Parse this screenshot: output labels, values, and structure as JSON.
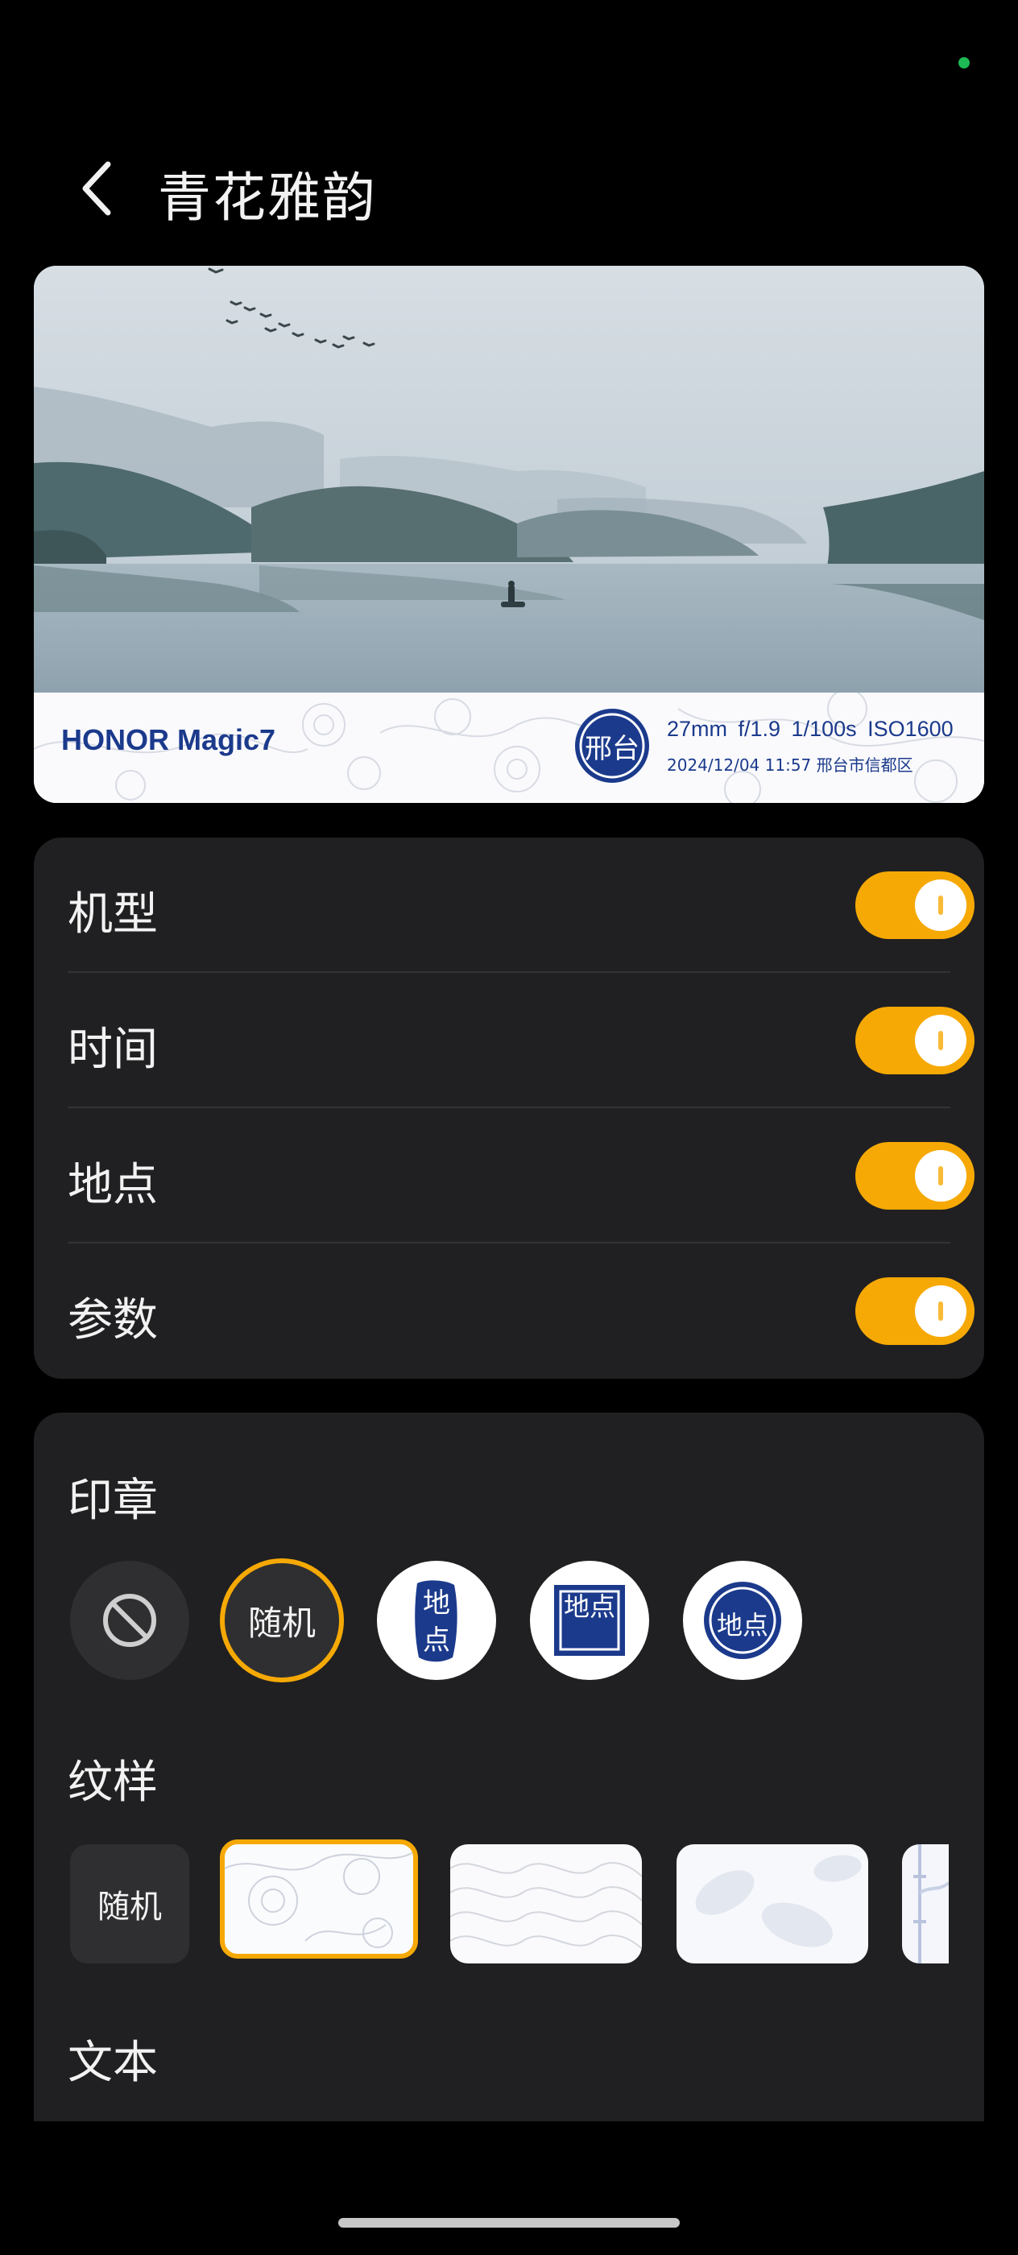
{
  "header": {
    "title": "青花雅韵",
    "back_icon": "back-arrow-icon"
  },
  "preview": {
    "brand": "HONOR Magic7",
    "seal_text": "邢台",
    "params": "27mm f/1.9 1/100s ISO1600",
    "meta": "2024/12/04 11:57 邢台市信都区",
    "accent": "#1b3a8c"
  },
  "toggles": [
    {
      "label": "机型",
      "on": true
    },
    {
      "label": "时间",
      "on": true
    },
    {
      "label": "地点",
      "on": true
    },
    {
      "label": "参数",
      "on": true
    }
  ],
  "stamp": {
    "title": "印章",
    "options": [
      {
        "type": "none",
        "icon": "no-entry-icon"
      },
      {
        "type": "random",
        "label": "随机",
        "selected": true
      },
      {
        "type": "vertical",
        "text": "地点"
      },
      {
        "type": "square",
        "text": "地点"
      },
      {
        "type": "round",
        "text": "地点"
      }
    ]
  },
  "pattern": {
    "title": "纹样",
    "random_label": "随机",
    "options": [
      "peony",
      "clouds",
      "leaves",
      "bamboo"
    ],
    "selected_index": 0
  },
  "text_section": {
    "title": "文本"
  },
  "colors": {
    "accent": "#f6a905",
    "card": "#202022",
    "blue": "#1b3a8c"
  }
}
